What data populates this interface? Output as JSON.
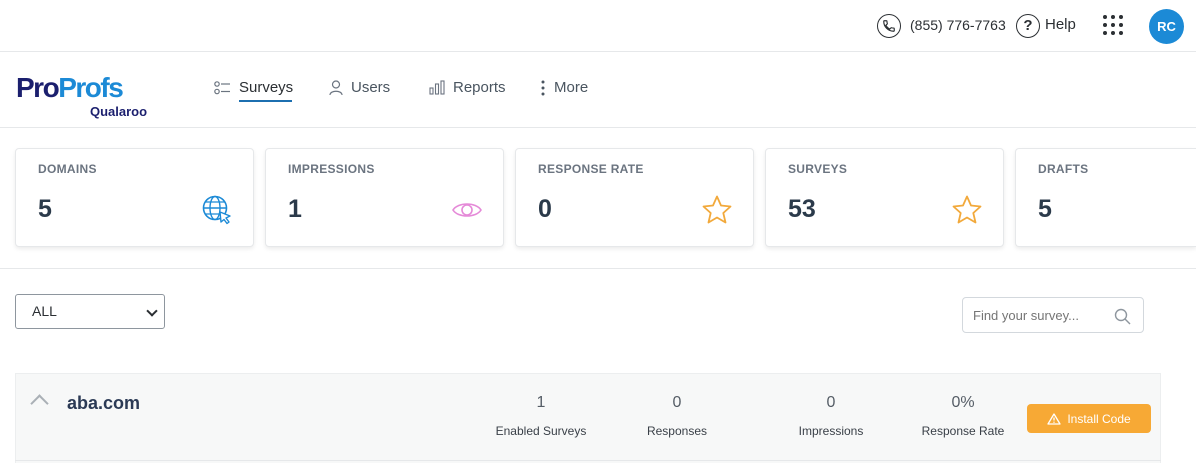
{
  "topbar": {
    "phone": "(855) 776-7763",
    "help_label": "Help",
    "avatar_initials": "RC"
  },
  "logo": {
    "pro": "Pro",
    "profs": "Profs",
    "product": "Qualaroo"
  },
  "nav": {
    "items": [
      {
        "label": "Surveys",
        "icon": "surveys-icon",
        "active": true
      },
      {
        "label": "Users",
        "icon": "user-icon"
      },
      {
        "label": "Reports",
        "icon": "bar-chart-icon"
      },
      {
        "label": "More",
        "icon": "vertical-dots-icon"
      }
    ]
  },
  "stats": [
    {
      "label": "DOMAINS",
      "value": "5",
      "icon": "globe-cursor-icon",
      "color": "#1c8ad6"
    },
    {
      "label": "IMPRESSIONS",
      "value": "1",
      "icon": "eye-icon",
      "color": "#e58ad8"
    },
    {
      "label": "RESPONSE RATE",
      "value": "0",
      "icon": "star-icon",
      "color": "#f2a93b"
    },
    {
      "label": "SURVEYS",
      "value": "53",
      "icon": "star-icon",
      "color": "#f2a93b"
    },
    {
      "label": "DRAFTS",
      "value": "5"
    }
  ],
  "filter": {
    "selected": "ALL"
  },
  "search": {
    "placeholder": "Find your survey..."
  },
  "domains": [
    {
      "name": "aba.com",
      "metrics": [
        {
          "value": "1",
          "label": "Enabled Surveys"
        },
        {
          "value": "0",
          "label": "Responses"
        },
        {
          "value": "0",
          "label": "Impressions"
        },
        {
          "value": "0%",
          "label": "Response Rate"
        }
      ],
      "install_label": "Install Code"
    }
  ],
  "colors": {
    "brand_blue": "#1c8ad6",
    "brand_navy": "#1b1f6e",
    "install_orange": "#f7a935"
  }
}
